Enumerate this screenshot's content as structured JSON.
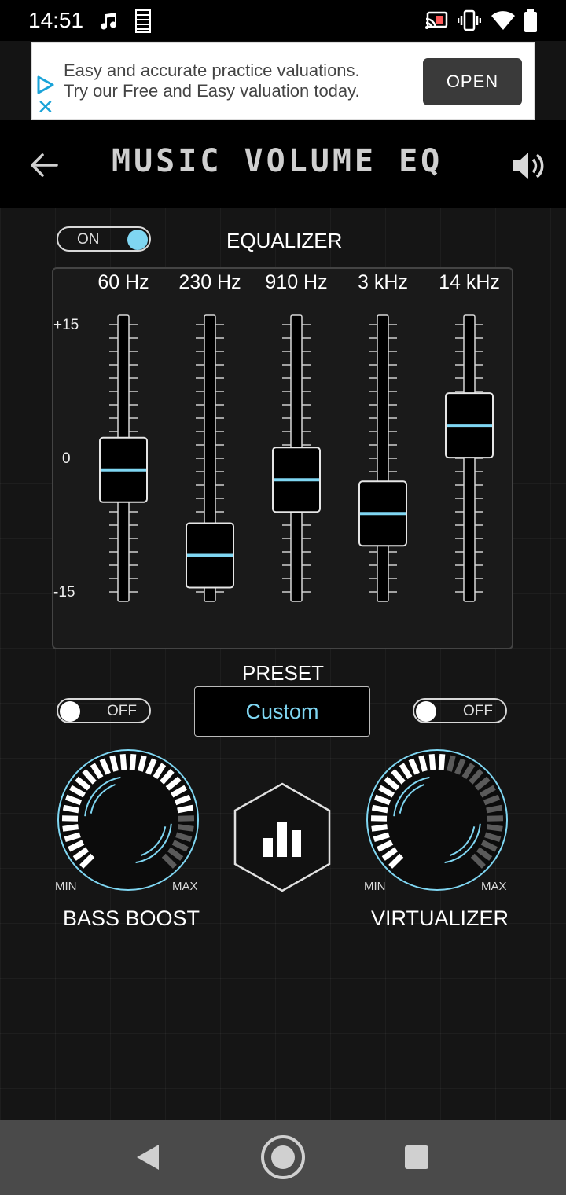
{
  "status": {
    "time": "14:51",
    "icons_left": [
      "music-note-icon",
      "signal-bars-icon"
    ],
    "icons_right": [
      "cast-icon",
      "vibrate-icon",
      "wifi-icon",
      "battery-icon"
    ]
  },
  "ad": {
    "line1": "Easy and accurate practice valuations.",
    "line2": "Try our Free and Easy valuation today.",
    "open_label": "OPEN"
  },
  "header": {
    "title": "MUSIC VOLUME EQ"
  },
  "equalizer": {
    "toggle_label": "ON",
    "title": "EQUALIZER",
    "scale_top": "+15",
    "scale_mid": "0",
    "scale_bottom": "-15",
    "bands": [
      {
        "label": "60 Hz",
        "value": -1.3
      },
      {
        "label": "230 Hz",
        "value": -10.9
      },
      {
        "label": "910 Hz",
        "value": -2.4
      },
      {
        "label": "3 kHz",
        "value": -6.2
      },
      {
        "label": "14 kHz",
        "value": 3.7
      }
    ]
  },
  "preset": {
    "title": "PRESET",
    "value": "Custom"
  },
  "bass_boost": {
    "toggle_label": "OFF",
    "label": "BASS BOOST",
    "min": "MIN",
    "max": "MAX",
    "level": 0.82
  },
  "virtualizer": {
    "toggle_label": "OFF",
    "label": "VIRTUALIZER",
    "min": "MIN",
    "max": "MAX",
    "level": 0.55
  },
  "colors": {
    "accent": "#7fd6f2",
    "toggle_on": "#7fd6f2"
  }
}
